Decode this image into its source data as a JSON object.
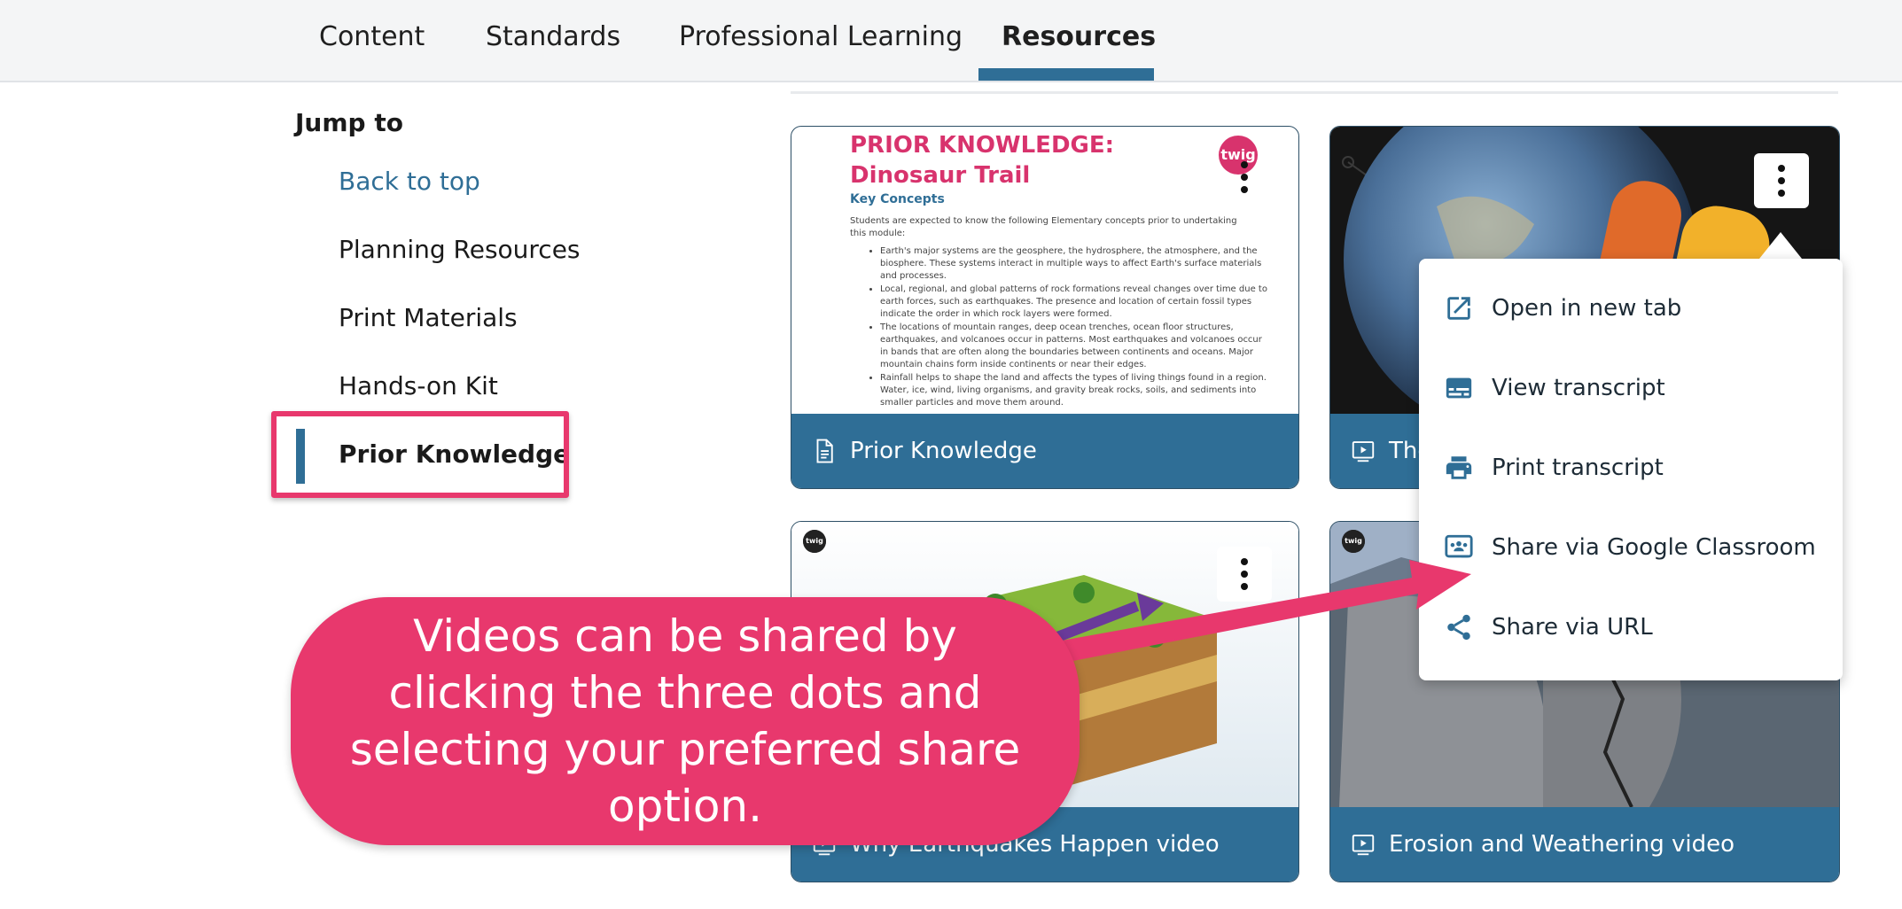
{
  "nav": {
    "tabs": [
      {
        "label": "Content"
      },
      {
        "label": "Standards"
      },
      {
        "label": "Professional Learning"
      },
      {
        "label": "Resources"
      }
    ]
  },
  "sidebar": {
    "heading": "Jump to",
    "items": [
      {
        "label": "Back to top"
      },
      {
        "label": "Planning Resources"
      },
      {
        "label": "Print Materials"
      },
      {
        "label": "Hands-on Kit"
      },
      {
        "label": "Prior Knowledge"
      }
    ]
  },
  "cards": {
    "prior_knowledge": {
      "footer": "Prior Knowledge",
      "doc_title_line1": "PRIOR KNOWLEDGE:",
      "doc_title_line2": "Dinosaur Trail",
      "badge": "twig",
      "key_concepts": "Key Concepts",
      "intro": "Students are expected to know the following Elementary concepts prior to undertaking this module:",
      "bullets": [
        "Earth's major systems are the geosphere, the hydrosphere, the atmosphere, and the biosphere. These systems interact in multiple ways to affect Earth's surface materials and processes.",
        "Local, regional, and global patterns of rock formations reveal changes over time due to earth forces, such as earthquakes. The presence and location of certain fossil types indicate the order in which rock layers were formed.",
        "The locations of mountain ranges, deep ocean trenches, ocean floor structures, earthquakes, and volcanoes occur in patterns. Most earthquakes and volcanoes occur in bands that are often along the boundaries between continents and oceans. Major mountain chains form inside continents or near their edges.",
        "Rainfall helps to shape the land and affects the types of living things found in a region. Water, ice, wind, living organisms, and gravity break rocks, soils, and sediments into smaller particles and move them around."
      ]
    },
    "earth_video": {
      "footer_partial": "The"
    },
    "earthquakes_video": {
      "footer": "Why Earthquakes Happen video",
      "badge": "twig"
    },
    "erosion_video": {
      "footer": "Erosion and Weathering video",
      "badge": "twig"
    }
  },
  "menu": {
    "items": [
      {
        "label": "Open in new tab",
        "icon": "open-new-tab-icon"
      },
      {
        "label": "View transcript",
        "icon": "subtitles-icon"
      },
      {
        "label": "Print transcript",
        "icon": "printer-icon"
      },
      {
        "label": "Share via Google Classroom",
        "icon": "google-classroom-icon"
      },
      {
        "label": "Share via URL",
        "icon": "share-icon"
      }
    ]
  },
  "callout": {
    "text": "Videos can be shared by clicking the three dots and selecting your preferred share option."
  },
  "colors": {
    "accent": "#2f6e96",
    "highlight": "#e8386d",
    "doc_title": "#d8336d"
  }
}
